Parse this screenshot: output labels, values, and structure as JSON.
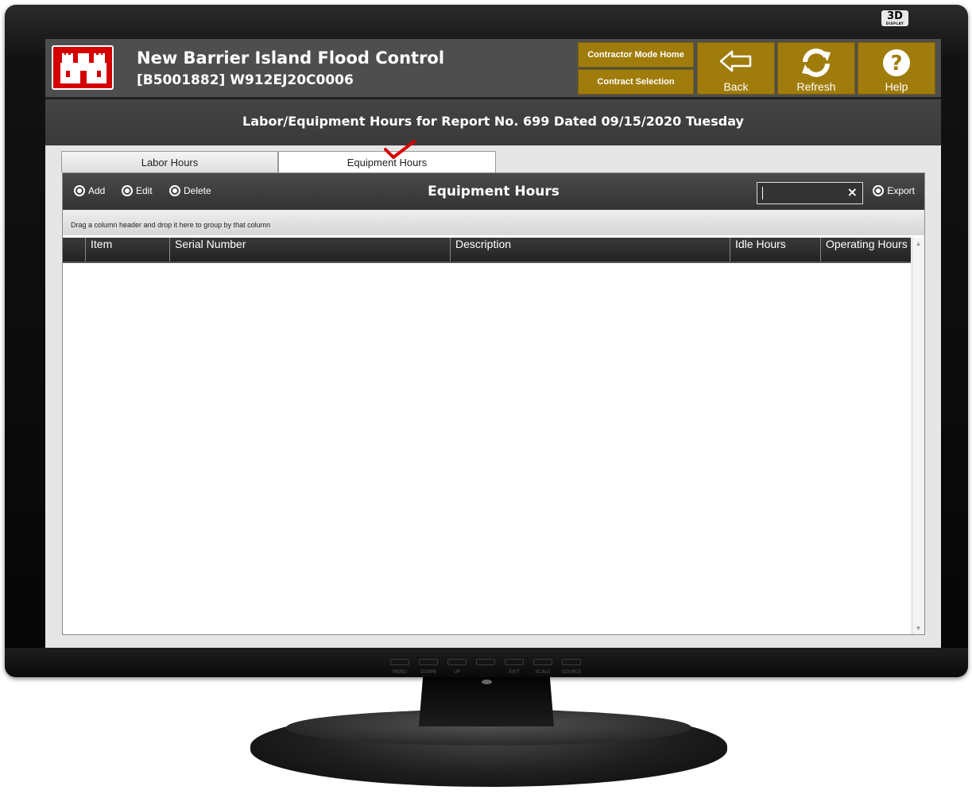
{
  "monitor": {
    "badge": "3D",
    "badge_sub": "DISPLAY",
    "hw_buttons": [
      "MENU",
      "DOWN",
      "UP",
      "",
      "EXIT",
      "SCALE",
      "SOURCE"
    ]
  },
  "header": {
    "title": "New Barrier Island Flood Control",
    "subtitle": "[B5001882] W912EJ20C0006",
    "contractor_mode_home": "Contractor Mode Home",
    "contract_selection": "Contract Selection",
    "back": "Back",
    "refresh": "Refresh",
    "help": "Help",
    "accent_color": "#a07c0c"
  },
  "page_title": "Labor/Equipment Hours for Report No. 699 Dated 09/15/2020 Tuesday",
  "tabs": [
    {
      "label": "Labor Hours",
      "active": false
    },
    {
      "label": "Equipment Hours",
      "active": true
    }
  ],
  "grid": {
    "title": "Equipment Hours",
    "toolbar": {
      "add": "Add",
      "edit": "Edit",
      "delete": "Delete",
      "export": "Export"
    },
    "search": {
      "value": "",
      "placeholder": ""
    },
    "group_hint": "Drag a column header and drop it here to group by that column",
    "columns": [
      "Item",
      "Serial Number",
      "Description",
      "Idle Hours",
      "Operating Hours"
    ],
    "rows": []
  }
}
